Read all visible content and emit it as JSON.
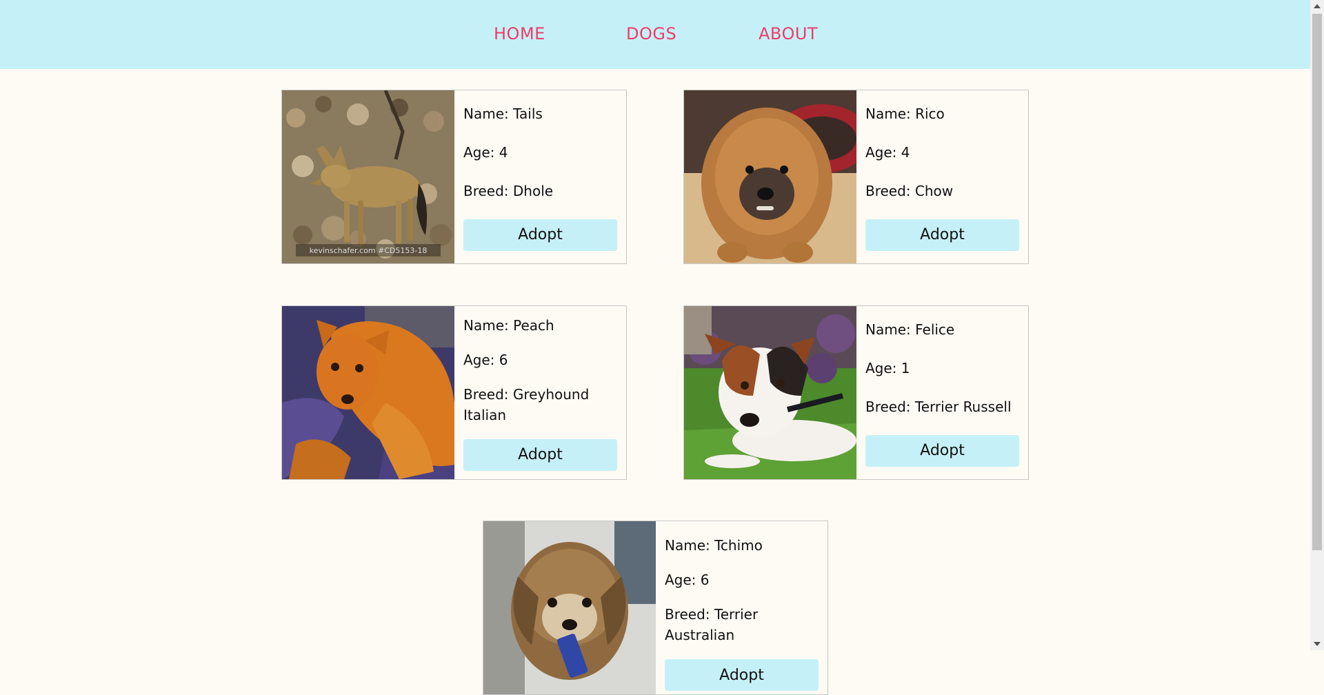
{
  "nav": {
    "home": "HOME",
    "dogs": "DOGS",
    "about": "ABOUT",
    "link_color": "#ed3d69",
    "bg_color": "#c6f0f7"
  },
  "dogs": [
    {
      "name": "Name: Tails",
      "age": "Age: 4",
      "breed": "Breed: Dhole",
      "button": "Adopt",
      "photo_caption": "kevinschafer.com #CD5153-18"
    },
    {
      "name": "Name: Rico",
      "age": "Age: 4",
      "breed": "Breed: Chow",
      "button": "Adopt"
    },
    {
      "name": "Name: Peach",
      "age": "Age: 6",
      "breed": "Breed: Greyhound Italian",
      "button": "Adopt"
    },
    {
      "name": "Name: Felice",
      "age": "Age: 1",
      "breed": "Breed: Terrier Russell",
      "button": "Adopt"
    },
    {
      "name": "Name: Tchimo",
      "age": "Age: 6",
      "breed": "Breed: Terrier Australian",
      "button": "Adopt"
    }
  ]
}
